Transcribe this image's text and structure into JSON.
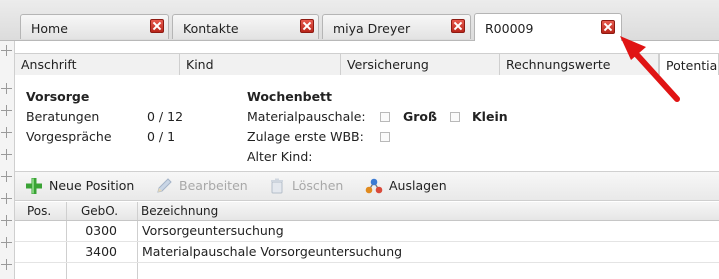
{
  "tabs": [
    {
      "label": "Home"
    },
    {
      "label": "Kontakte"
    },
    {
      "label": "miya Dreyer"
    },
    {
      "label": "R00009",
      "active": true
    }
  ],
  "subtabs": [
    {
      "label": "Anschrift"
    },
    {
      "label": "Kind"
    },
    {
      "label": "Versicherung"
    },
    {
      "label": "Rechnungswerte"
    },
    {
      "label": "Potentia",
      "active": true
    }
  ],
  "vorsorge": {
    "heading": "Vorsorge",
    "beratungen_label": "Beratungen",
    "beratungen_value": "0 / 12",
    "vorgesprache_label": "Vorgespräche",
    "vorgesprache_value": "0 / 1"
  },
  "wochenbett": {
    "heading": "Wochenbett",
    "materialpauschale_label": "Materialpauschale:",
    "gross_label": "Groß",
    "klein_label": "Klein",
    "zulage_label": "Zulage erste WBB:",
    "alter_label": "Alter Kind:"
  },
  "toolbar": {
    "new_position": "Neue Position",
    "edit": "Bearbeiten",
    "delete": "Löschen",
    "expenses": "Auslagen"
  },
  "grid": {
    "columns": [
      "Pos.",
      "GebO.",
      "Bezeichnung"
    ],
    "rows": [
      {
        "pos": "",
        "gebo": "0300",
        "bezeichnung": "Vorsorgeuntersuchung"
      },
      {
        "pos": "",
        "gebo": "3400",
        "bezeichnung": "Materialpauschale Vorsorgeuntersuchung"
      }
    ]
  },
  "colors": {
    "close_button": "#d13a2e",
    "annotation_arrow": "#e01414",
    "add_icon": "#3aa335"
  },
  "icons": {
    "tab_close": "close-icon",
    "new_position": "plus-icon",
    "edit": "pencil-icon",
    "delete": "trash-icon",
    "expenses": "molecule-icon"
  }
}
